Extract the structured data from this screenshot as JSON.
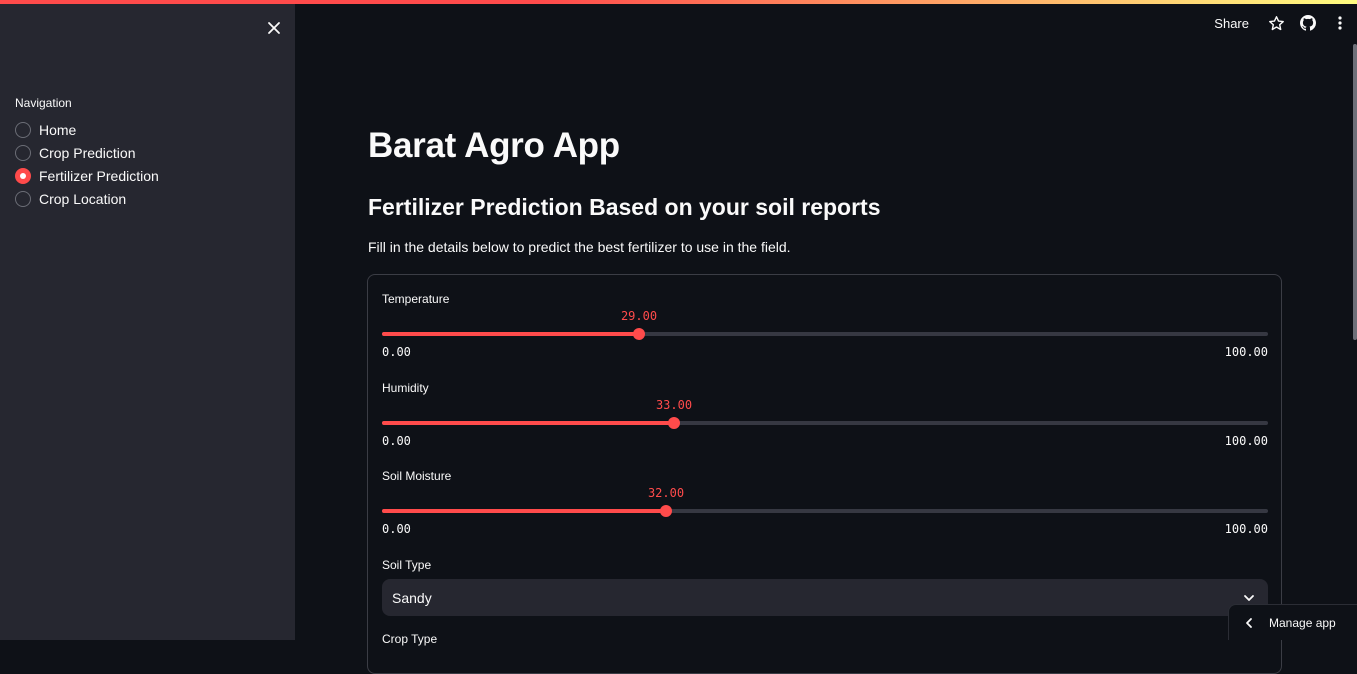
{
  "header": {
    "share_label": "Share"
  },
  "sidebar": {
    "title": "Navigation",
    "items": [
      {
        "label": "Home",
        "selected": false
      },
      {
        "label": "Crop Prediction",
        "selected": false
      },
      {
        "label": "Fertilizer Prediction",
        "selected": true
      },
      {
        "label": "Crop Location",
        "selected": false
      }
    ]
  },
  "main": {
    "title": "Barat Agro App",
    "subtitle": "Fertilizer Prediction Based on your soil reports",
    "description": "Fill in the details below to predict the best fertilizer to use in the field.",
    "sliders": [
      {
        "label": "Temperature",
        "value": "29.00",
        "min": "0.00",
        "max": "100.00",
        "fraction": 0.29
      },
      {
        "label": "Humidity",
        "value": "33.00",
        "min": "0.00",
        "max": "100.00",
        "fraction": 0.33
      },
      {
        "label": "Soil Moisture",
        "value": "32.00",
        "min": "0.00",
        "max": "100.00",
        "fraction": 0.32
      }
    ],
    "soil_type": {
      "label": "Soil Type",
      "value": "Sandy"
    },
    "crop_type": {
      "label": "Crop Type"
    }
  },
  "manage_app": {
    "label": "Manage app"
  },
  "colors": {
    "accent": "#ff4b4b",
    "background": "#0e1117",
    "sidebar": "#262730"
  }
}
